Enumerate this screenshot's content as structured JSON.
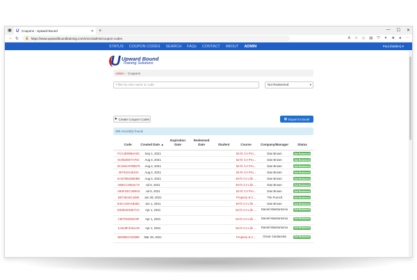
{
  "browser": {
    "tab_title": "Coupons - Upward Bound",
    "tab_logo": "U",
    "url": "https://www.upwardboundtraining.com/micro/admin/coupon-codes",
    "icons": [
      "minimize-icon",
      "maximize-icon",
      "close-icon"
    ]
  },
  "sitenav": {
    "items": [
      {
        "label": "STATUS"
      },
      {
        "label": "COUPON CODES"
      },
      {
        "label": "SEARCH"
      },
      {
        "label": "FAQs"
      },
      {
        "label": "CONTACT"
      },
      {
        "label": "ABOUT"
      },
      {
        "label": "ADMIN"
      }
    ],
    "active": "ADMIN",
    "user": "Paul (hidden) ▾"
  },
  "logo": {
    "mark": "U",
    "line1": "Upward Bound",
    "line2": "Training Solutions"
  },
  "breadcrumb": {
    "link": "Admin",
    "separator": "/",
    "current": "Coupons"
  },
  "filter": {
    "placeholder": "Filter by user name or code",
    "status_value": "Not Redeemed"
  },
  "buttons": {
    "create": "Create Coupon Codes",
    "export": "Export to Excel"
  },
  "records_text": "305 record(s) found.",
  "table": {
    "headers": {
      "code": "Code",
      "created": "Created Date ▲",
      "expiration": "Expiration Date",
      "redeemed": "Redeemed Date",
      "student": "Student",
      "course": "Course",
      "company": "Company/Manager",
      "status": "Status"
    },
    "rows": [
      {
        "code": "FCA4D9962A6C",
        "created": "Sep 1, 2021",
        "course": "52-hr CA Pro...",
        "company": "Dan Brown",
        "status": "Not Redeemed"
      },
      {
        "code": "6C052EE7A70C",
        "created": "Aug 4, 2021",
        "course": "52-hr CA Pro...",
        "company": "Dan Brown",
        "status": "Not Redeemed"
      },
      {
        "code": "3C1604AF8B575",
        "created": "Aug 4, 2021",
        "course": "52-hr CA Pro...",
        "company": "Dan Brown",
        "status": "Not Redeemed"
      },
      {
        "code": "267510145104",
        "created": "Aug 4, 2021",
        "course": "52-hr CA Pro...",
        "company": "Dan Brown",
        "status": "Not Redeemed"
      },
      {
        "code": "EAD7B51B60B8",
        "created": "Aug 4, 2021",
        "course": "40-hr CA Life ...",
        "company": "Dan Brown",
        "status": "Not Redeemed"
      },
      {
        "code": "AB5CC4054C72",
        "created": "Jul 5, 2021",
        "course": "40-hr CA Life ...",
        "company": "Dan Brown",
        "status": "Not Redeemed"
      },
      {
        "code": "AB4F53C1ME04",
        "created": "Jul 5, 2021",
        "course": "52-hr CA Pro...",
        "company": "Dan Brown",
        "status": "Not Redeemed"
      },
      {
        "code": "B5745A8C4286",
        "created": "Jun 28, 2021",
        "course": "Property & C...",
        "company": "Tim Purcell",
        "status": "Not Redeemed"
      },
      {
        "code": "E4CA19AAB36C",
        "created": "Jun 1, 2021",
        "course": "40-hr CA Life ...",
        "company": "Dan Brown",
        "status": "Not Redeemed"
      },
      {
        "code": "E938AE33E7CC",
        "created": "Apr 1, 2021",
        "course": "52-hr CA Life ...",
        "company": "Daniel Mastrantonio",
        "status": "Not Redeemed"
      },
      {
        "code": "C5FF84304C8F",
        "created": "Apr 1, 2021",
        "course": "52-hr CA Life ...",
        "company": "Daniel Mastrantonio",
        "status": "Not Redeemed"
      },
      {
        "code": "1A6A9F3A6AA9",
        "created": "Apr 1, 2021",
        "course": "52-hr CA Life ...",
        "company": "Daniel Mastrantonio",
        "status": "Not Redeemed"
      },
      {
        "code": "B6D9DC022966",
        "created": "Mar 29, 2021",
        "course": "Property & C...",
        "company": "Oscar Castaneda",
        "status": "Not Redeemed"
      }
    ]
  }
}
